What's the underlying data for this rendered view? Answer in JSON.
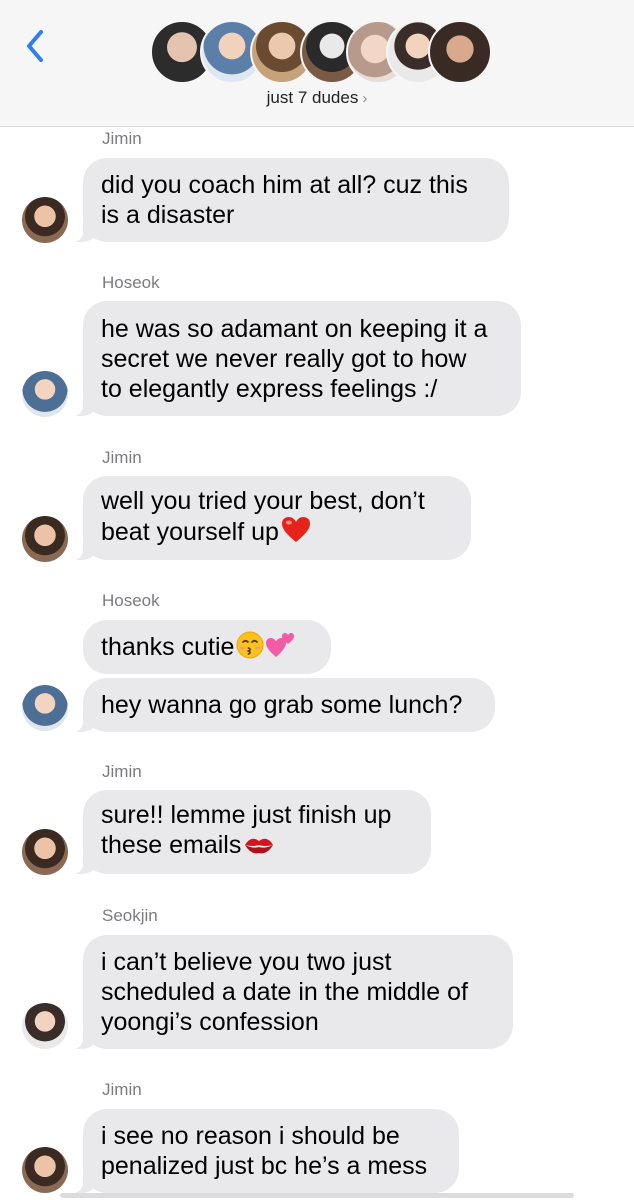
{
  "header": {
    "group_name": "just 7 dudes",
    "chevron": "›",
    "back_icon": "chevron-left-icon",
    "accent": "#2f7cf6"
  },
  "messages": [
    {
      "sender": "Jimin",
      "text": "did you coach him at all? cuz this\nis a disaster"
    },
    {
      "sender": "Hoseok",
      "text": "he was so adamant on keeping it a\nsecret we never really got to how\nto elegantly express feelings :/"
    },
    {
      "sender": "Jimin",
      "text": "well you tried your best, don’t\nbeat yourself up",
      "emoji": "heart-icon"
    },
    {
      "sender": "Hoseok",
      "text": "thanks cutie",
      "emoji": "kissing-face-icon, two-hearts-icon"
    },
    {
      "text": "hey wanna go grab some lunch?"
    },
    {
      "sender": "Jimin",
      "text": "sure!! lemme just finish up\nthese emails",
      "emoji": "kiss-mark-icon"
    },
    {
      "sender": "Seokjin",
      "text": "i can’t believe you two just\nscheduled a date in the middle of\nyoongi’s confession"
    },
    {
      "sender": "Jimin",
      "text": "i see no reason i should be\npenalized just bc he’s a mess"
    }
  ],
  "colors": {
    "bubble": "#e9e9eb",
    "sender_label": "#7c7c80",
    "header_bg": "#f6f6f6"
  }
}
